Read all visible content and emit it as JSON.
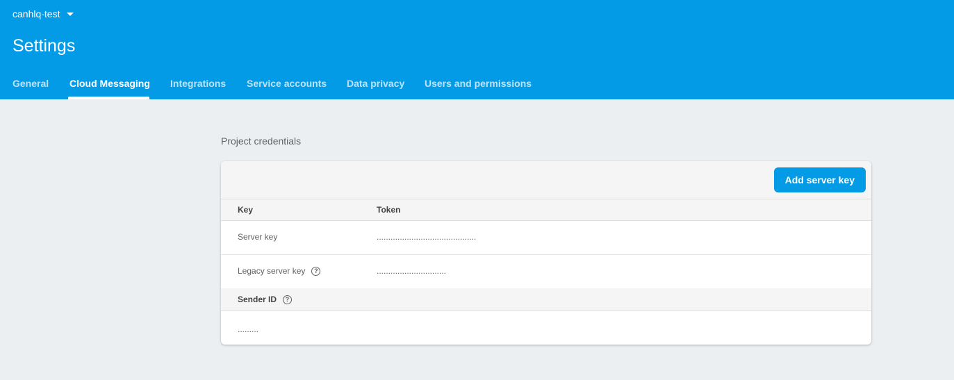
{
  "header": {
    "project_name": "canhlq-test",
    "title": "Settings",
    "tabs": [
      {
        "label": "General",
        "active": false
      },
      {
        "label": "Cloud Messaging",
        "active": true
      },
      {
        "label": "Integrations",
        "active": false
      },
      {
        "label": "Service accounts",
        "active": false
      },
      {
        "label": "Data privacy",
        "active": false
      },
      {
        "label": "Users and permissions",
        "active": false
      }
    ]
  },
  "credentials": {
    "section_title": "Project credentials",
    "add_button_label": "Add server key",
    "columns": [
      "Key",
      "Token"
    ],
    "rows": [
      {
        "key": "Server key",
        "token": "..........................................."
      },
      {
        "key": "Legacy server key",
        "token": ".............................."
      }
    ],
    "sender_id_label": "Sender ID",
    "sender_id_value": "........."
  },
  "colors": {
    "brand": "#039be5",
    "background": "#eceff1"
  },
  "icons": {
    "project_dropdown": "caret-down-icon",
    "help": "help-circle-icon"
  }
}
